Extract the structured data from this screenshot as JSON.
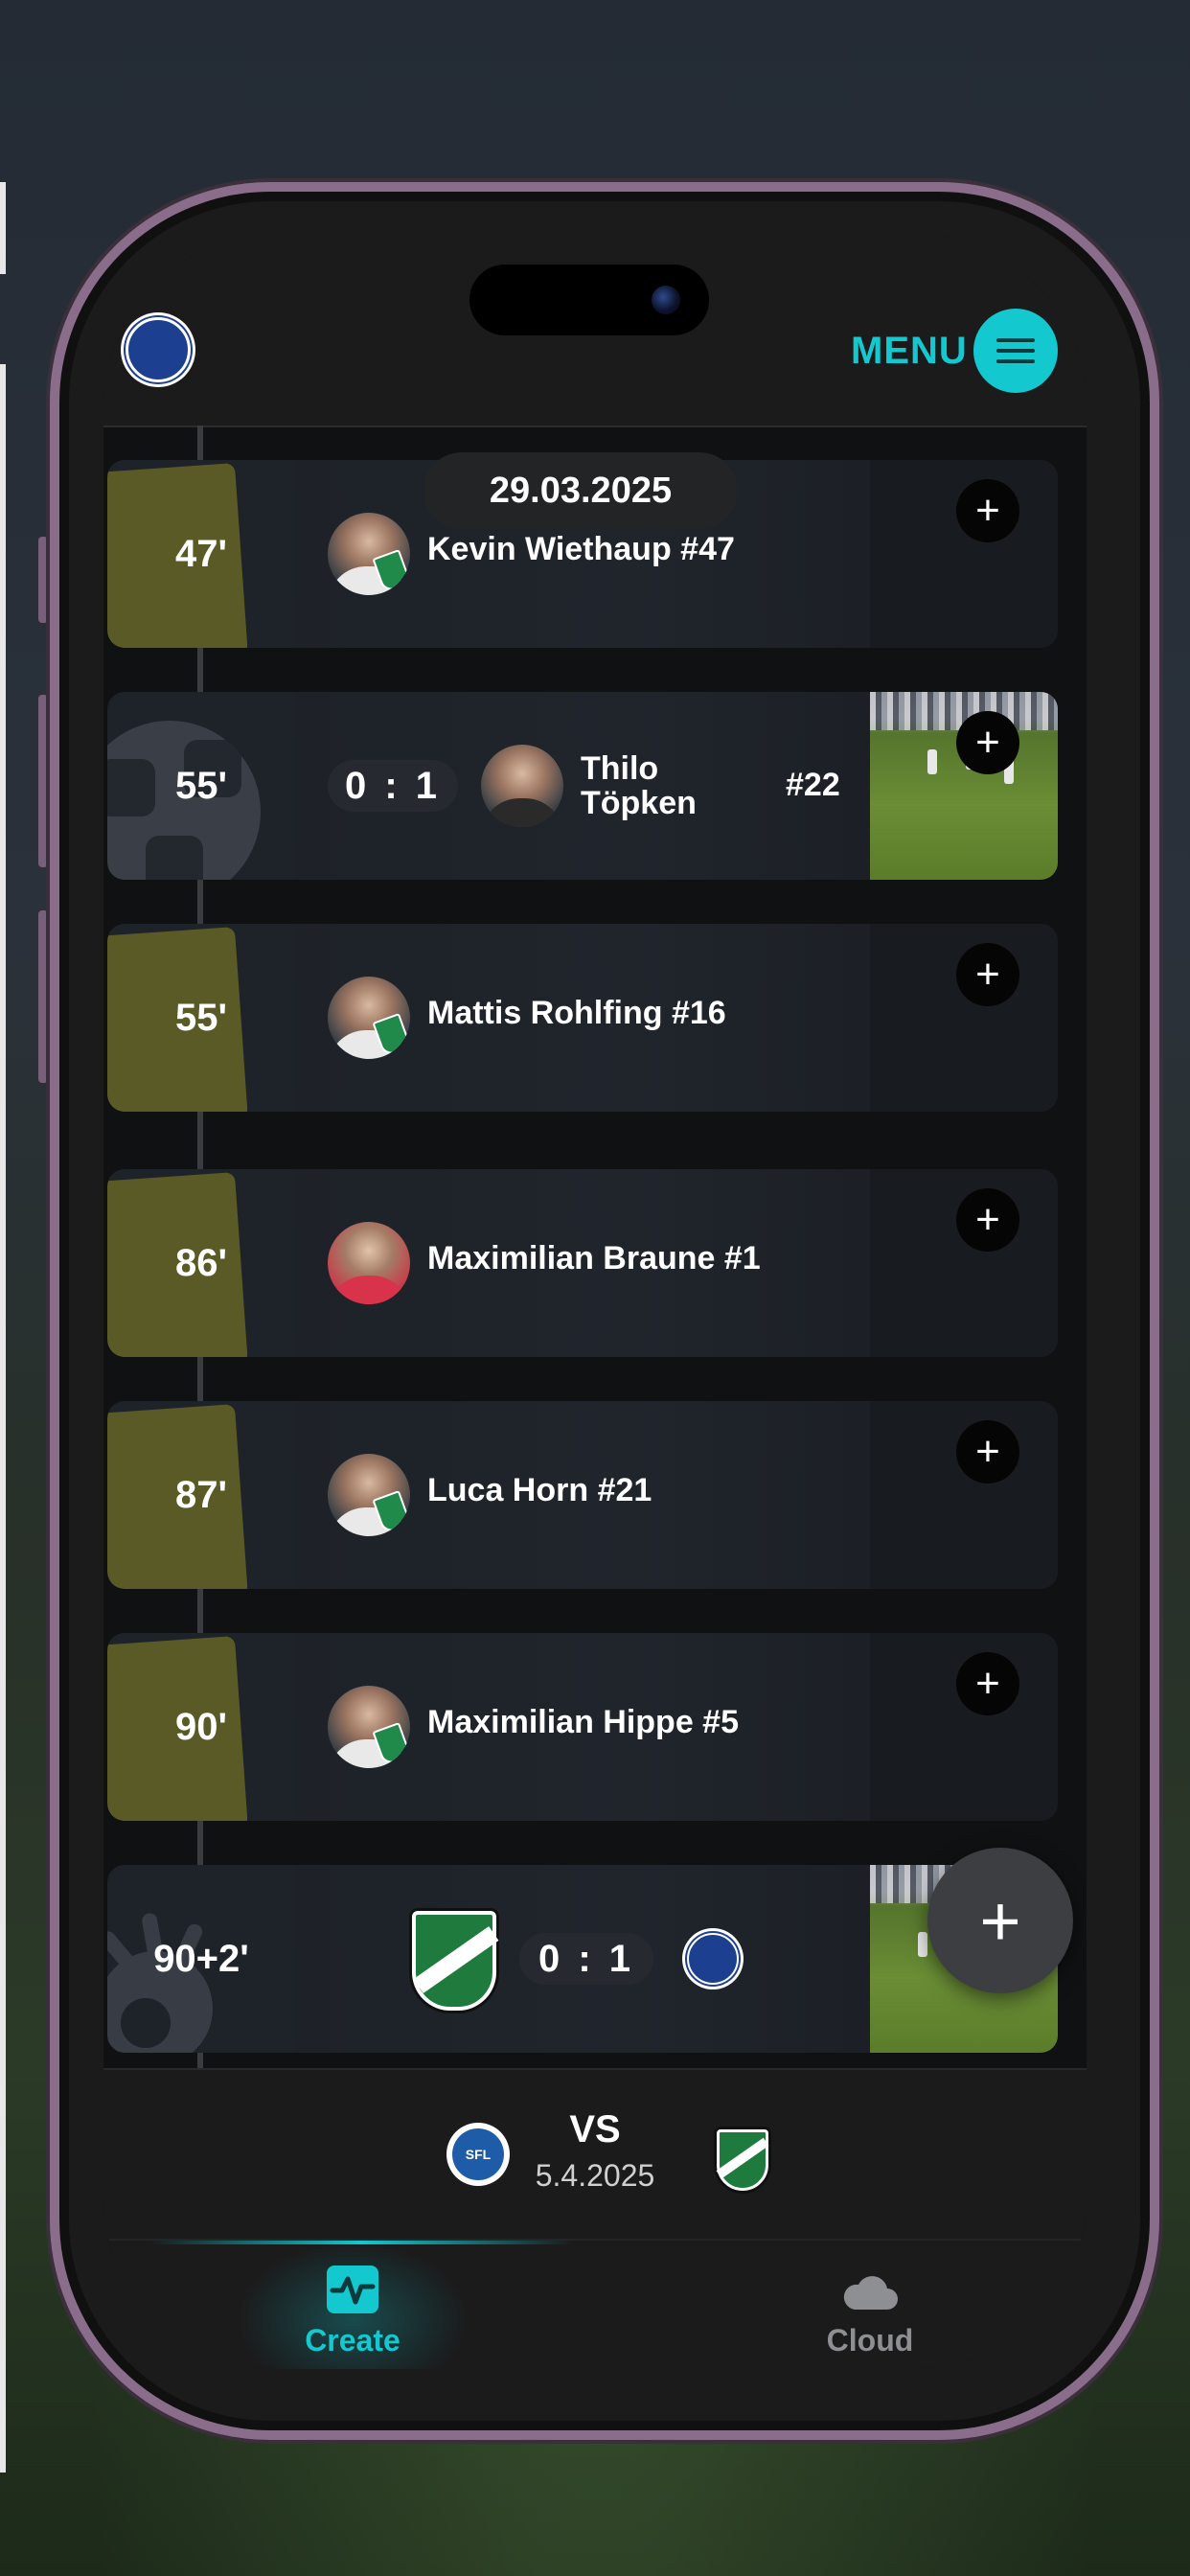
{
  "header": {
    "menu_label": "MENU",
    "logo_icon": "club-crest-icon",
    "menu_icon": "hamburger-icon"
  },
  "date": "29.03.2025",
  "events": [
    {
      "minute": "47'",
      "type": "yellow-card",
      "player": "Kevin Wiethaup #47"
    },
    {
      "minute": "55'",
      "type": "goal",
      "score": "0 : 1",
      "player_line1": "Thilo",
      "player_line2": "Töpken",
      "number": "#22"
    },
    {
      "minute": "55'",
      "type": "yellow-card",
      "player": "Mattis Rohlfing #16"
    },
    {
      "minute": "86'",
      "type": "yellow-card",
      "player": "Maximilian Braune #1"
    },
    {
      "minute": "87'",
      "type": "yellow-card",
      "player": "Luca Horn #21"
    },
    {
      "minute": "90'",
      "type": "yellow-card",
      "player": "Maximilian Hippe #5"
    },
    {
      "minute": "90+2'",
      "type": "final-whistle",
      "score": "0 : 1"
    }
  ],
  "fab_label": "+",
  "plus_label": "+",
  "next_match": {
    "vs": "VS",
    "date": "5.4.2025"
  },
  "tabs": [
    {
      "label": "Create",
      "icon": "pulse-icon",
      "active": true
    },
    {
      "label": "Cloud",
      "icon": "cloud-icon",
      "active": false
    }
  ],
  "colors": {
    "accent": "#13c8cf",
    "card": "#5a5a26",
    "background": "#101112"
  }
}
